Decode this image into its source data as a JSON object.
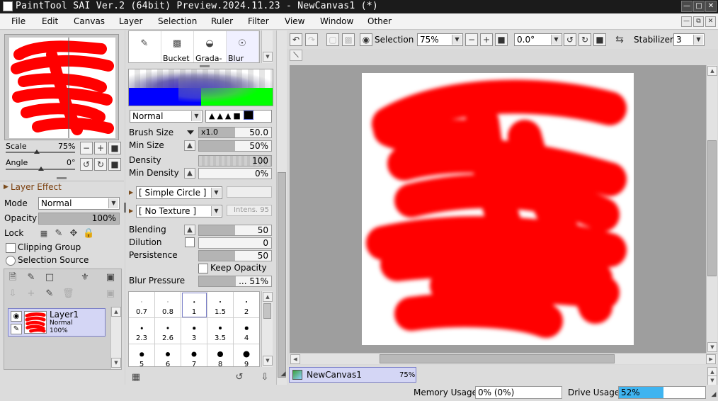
{
  "window": {
    "title": "PaintTool SAI Ver.2 (64bit) Preview.2024.11.23 - NewCanvas1 (*)"
  },
  "menu": [
    "File",
    "Edit",
    "Canvas",
    "Layer",
    "Selection",
    "Ruler",
    "Filter",
    "View",
    "Window",
    "Other"
  ],
  "navigator": {
    "scale_label": "Scale",
    "scale_value": "75%",
    "angle_label": "Angle",
    "angle_value": "0°"
  },
  "layer_panel": {
    "effect_label": "Layer Effect",
    "mode_label": "Mode",
    "mode_value": "Normal",
    "opacity_label": "Opacity",
    "opacity_value": "100%",
    "opacity_fraction": 1.0,
    "lock_label": "Lock",
    "clipping_label": "Clipping Group",
    "selection_source_label": "Selection Source",
    "layers": [
      {
        "name": "Layer1",
        "mode": "Normal",
        "opacity": "100%"
      }
    ]
  },
  "tools": [
    {
      "label": "Bucket"
    },
    {
      "label": "Grada-"
    },
    {
      "label": "Blur"
    }
  ],
  "brush": {
    "blend_mode": "Normal",
    "size_label": "Brush Size",
    "size_mult": "x1.0",
    "size_value": "50.0",
    "size_fraction": 0.5,
    "min_size_label": "Min Size",
    "min_size_value": "50%",
    "min_size_fraction": 0.5,
    "density_label": "Density",
    "density_value": "100",
    "density_fraction": 1.0,
    "min_density_label": "Min Density",
    "min_density_value": "0%",
    "min_density_fraction": 0.0,
    "shape_value": "[ Simple Circle ]",
    "texture_value": "[ No Texture ]",
    "texture_intensity": "Intens. 95",
    "blending_label": "Blending",
    "blending_value": "50",
    "blending_fraction": 0.5,
    "dilution_label": "Dilution",
    "dilution_value": "0",
    "dilution_fraction": 0.0,
    "persistence_label": "Persistence",
    "persistence_value": "50",
    "persistence_fraction": 0.5,
    "keep_opacity_label": "Keep Opacity",
    "blur_pressure_label": "Blur Pressure",
    "blur_pressure_value": "... 51%",
    "blur_pressure_fraction": 0.51,
    "sizes": [
      "0.7",
      "0.8",
      "1",
      "1.5",
      "2",
      "2.3",
      "2.6",
      "3",
      "3.5",
      "4",
      "5",
      "6",
      "7",
      "8",
      "9"
    ]
  },
  "toolbar": {
    "selection_label": "Selection",
    "zoom_value": "75%",
    "angle_value": "0.0°",
    "stabilizer_label": "Stabilizer",
    "stabilizer_value": "3"
  },
  "canvas_tab": {
    "name": "NewCanvas1",
    "zoom": "75%"
  },
  "status": {
    "memory_label": "Memory Usage",
    "memory_value": "0% (0%)",
    "drive_label": "Drive Usage",
    "drive_value": "52%",
    "drive_fraction": 0.52
  },
  "colors": {
    "paint": "#ff0000",
    "title_bar": "#1b1b1b",
    "drive_fill": "#3fb4f0",
    "layer_selected": "#d4d6f5"
  },
  "icons": [
    "app-icon",
    "minimize-icon",
    "maximize-icon",
    "close-icon",
    "eye-icon",
    "pen-icon",
    "rotate-ccw-icon",
    "rotate-cw-icon",
    "reset-icon",
    "flip-icon",
    "undo-icon",
    "redo-icon",
    "new-layer-icon",
    "trash-icon",
    "lock-icon",
    "move-icon",
    "checker-icon",
    "canvas-icon",
    "scroll-up-icon",
    "scroll-down-icon",
    "scroll-left-icon",
    "scroll-right-icon"
  ]
}
